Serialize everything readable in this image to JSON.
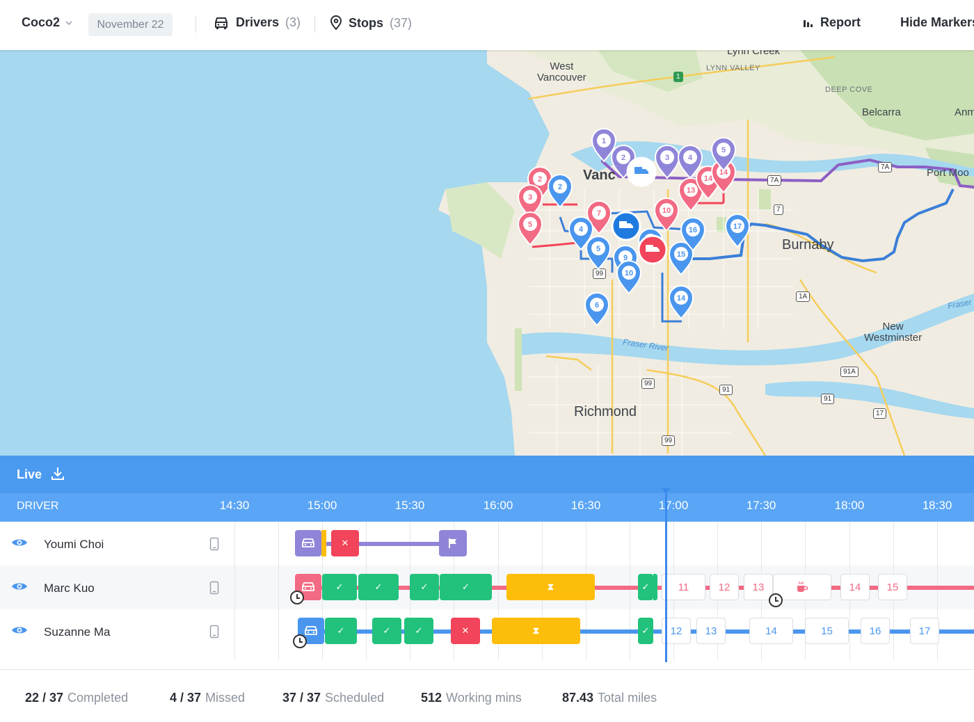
{
  "header": {
    "org": "Coco2",
    "date": "November 22",
    "drivers_label": "Drivers",
    "drivers_count": "(3)",
    "stops_label": "Stops",
    "stops_count": "(37)",
    "report_label": "Report",
    "hide_markers_label": "Hide Markers"
  },
  "map": {
    "labels": {
      "west_vancouver": "West\nVancouver",
      "lynn_creek": "Lynn Creek",
      "lynn_valley": "LYNN VALLEY",
      "deep_cove": "DEEP COVE",
      "belcarra": "Belcarra",
      "anmore": "Anm",
      "vancouver": "Vanc",
      "port_moody": "Port Moo",
      "burnaby": "Burnaby",
      "new_westminster": "New\nWestminster",
      "richmond": "Richmond",
      "fraser_river": "Fraser River",
      "fraser": "Fraser"
    },
    "shields": [
      "1",
      "7A",
      "7A",
      "7",
      "99",
      "1A",
      "91A",
      "99",
      "91",
      "91",
      "17",
      "99"
    ],
    "markers_purple": [
      "1",
      "2",
      "3",
      "4",
      "5"
    ],
    "markers_pink": [
      "2",
      "3",
      "5",
      "7",
      "10",
      "13",
      "14",
      "14"
    ],
    "markers_blue": [
      "2",
      "4",
      "5",
      "6",
      "9",
      "10",
      "12",
      "14",
      "15",
      "16",
      "17"
    ]
  },
  "live": {
    "label": "Live",
    "driver_col": "DRIVER",
    "times": [
      "14:30",
      "15:00",
      "15:30",
      "16:00",
      "16:30",
      "17:00",
      "17:30",
      "18:00",
      "18:30"
    ]
  },
  "drivers": [
    {
      "name": "Youmi Choi",
      "color": "#8f85d8"
    },
    {
      "name": "Marc Kuo",
      "color": "#f26a83",
      "pending": [
        "11",
        "12",
        "13",
        "14",
        "15"
      ]
    },
    {
      "name": "Suzanne Ma",
      "color": "#4a96ee",
      "pending": [
        "12",
        "13",
        "14",
        "15",
        "16",
        "17"
      ]
    }
  ],
  "footer": {
    "completed_value": "22 / 37",
    "completed_label": "Completed",
    "missed_value": "4 / 37",
    "missed_label": "Missed",
    "scheduled_value": "37 / 37",
    "scheduled_label": "Scheduled",
    "working_value": "512",
    "working_label": "Working mins",
    "miles_value": "87.43",
    "miles_label": "Total miles"
  },
  "colors": {
    "accent": "#4a9af0",
    "complete": "#22c27d",
    "missed": "#f2445a",
    "waiting": "#fdbd0b",
    "purple": "#8f85d8",
    "pink": "#f26a83",
    "blue": "#4a96ee"
  }
}
